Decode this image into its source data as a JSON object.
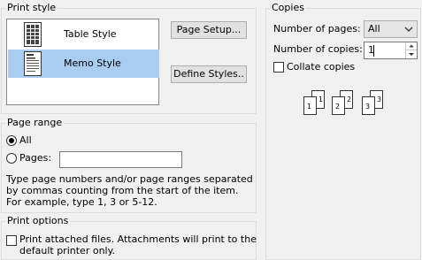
{
  "print_style": {
    "title": "Print style",
    "styles": [
      {
        "label": "Table Style",
        "icon": "table-style-icon",
        "selected": false
      },
      {
        "label": "Memo Style",
        "icon": "memo-style-icon",
        "selected": true
      }
    ],
    "page_setup_button": "Page Setup...",
    "define_styles_button": "Define Styles.."
  },
  "copies": {
    "title": "Copies",
    "number_of_pages_label": "Number of pages:",
    "number_of_pages_value": "All",
    "number_of_copies_label": "Number of copies:",
    "number_of_copies_value": "1",
    "collate_label": "Collate copies",
    "collate_checked": false,
    "collate_icon_numbers": [
      "1",
      "1",
      "2",
      "2",
      "3",
      "3"
    ]
  },
  "page_range": {
    "title": "Page range",
    "all_label": "All",
    "all_selected": true,
    "pages_label": "Pages:",
    "pages_value": "",
    "help_text": "Type page numbers and/or page ranges separated by commas counting from the start of the item.  For example, type 1, 3 or 5-12."
  },
  "print_options": {
    "title": "Print options",
    "attach_label_line1": "Print attached files.  Attachments will print to the",
    "attach_label_line2": "default printer only.",
    "attach_checked": false
  },
  "colors": {
    "window_bg": "#f0f0f0",
    "selection": "#a8cdf1",
    "group_border": "#dcdcdc",
    "button_face": "#e1e1e1"
  }
}
